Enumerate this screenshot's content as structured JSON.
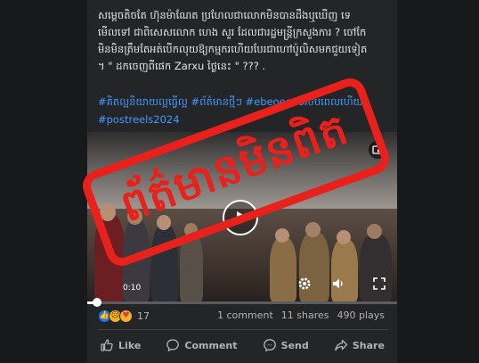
{
  "post": {
    "caption_lines": [
      "សម្ដេចតិចតែ ហ៊ុនម៉ាណែត ប្រហែលជាលោកមិនបានដឹងឬឃើញ ទេ",
      "មើលទៅ ជាពិសេសលោក ហេង សួរ ដែលជារដ្ឋមន្ត្រីក្រសួងការ ? ចៅកែ",
      "មិនមិនត្រឹមតែអត់បើកលុយឱ្យកម្មករហើយបែរជាហៅប៉ូលិសមកជួយទៀត",
      "។ \" ដកចេញពីផេក Zarxu ថ្ងៃនេះ \" ??? ."
    ],
    "hashtags": [
      "#គិតល្អនិយាយល្អធ្វើល្អ #ព័ត៌មានថ្មីៗ #ebeoeoeoរចប់ពេលហើយ",
      "#postreels2024"
    ]
  },
  "video": {
    "time": "0:10",
    "progress": 0.02
  },
  "stamp": {
    "text": "ព័ត៌មានមិនពិត",
    "color": "#e8211c"
  },
  "stats": {
    "reaction_count": "17",
    "comments": "1 comment",
    "shares": "11 shares",
    "plays": "490 plays"
  },
  "actions": {
    "like": "Like",
    "comment": "Comment",
    "send": "Send",
    "share": "Share"
  },
  "colors": {
    "card_bg": "#242526",
    "hashtag": "#4599ff",
    "muted_text": "#b0b3b8",
    "like_blue": "#1877f2"
  },
  "icons": [
    "pip-icon",
    "play-icon",
    "settings-icon",
    "volume-icon",
    "fullscreen-icon",
    "like-icon",
    "comment-icon",
    "messenger-icon",
    "share-icon"
  ]
}
